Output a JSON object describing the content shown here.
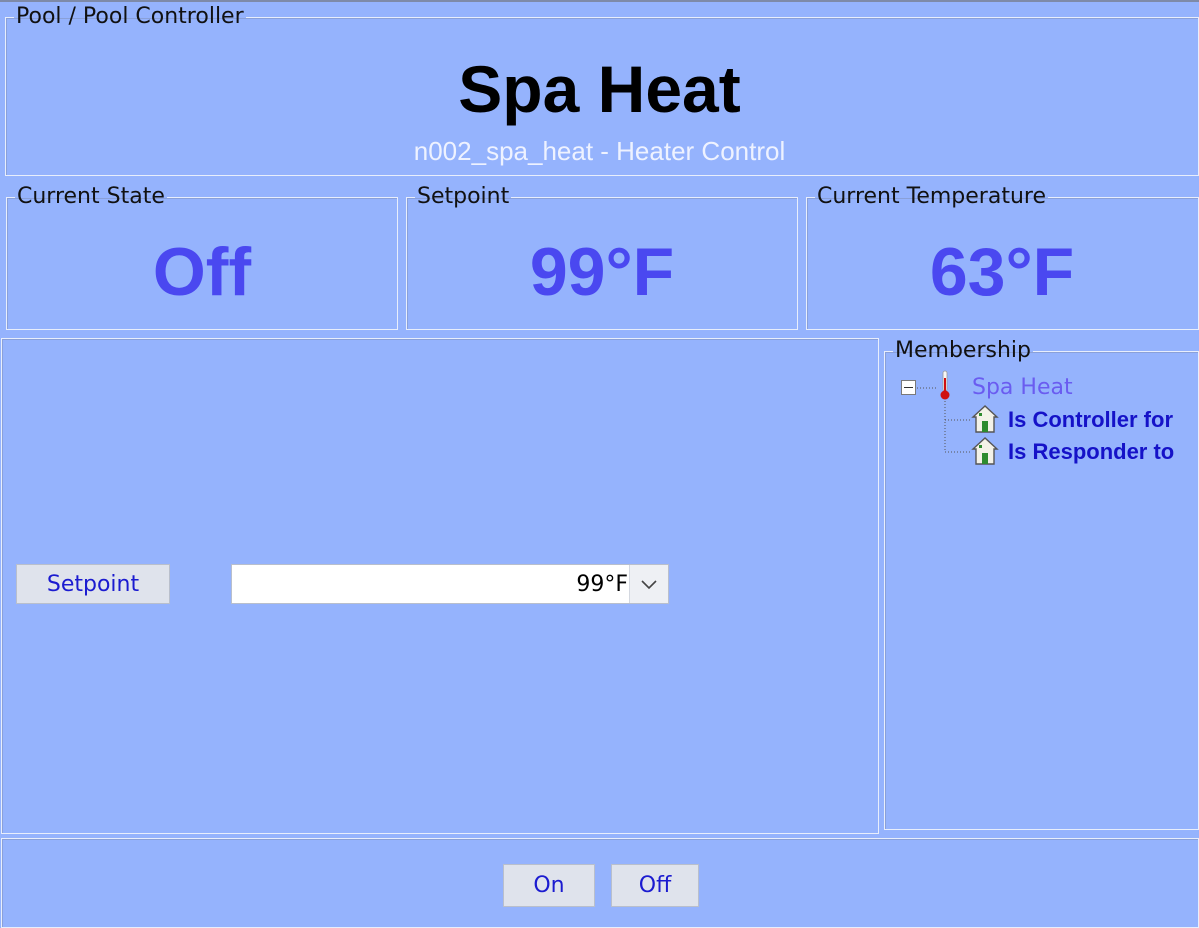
{
  "header": {
    "breadcrumb": "Pool / Pool Controller",
    "title": "Spa Heat",
    "subtitle": "n002_spa_heat - Heater Control"
  },
  "status": {
    "current_state": {
      "label": "Current State",
      "value": "Off"
    },
    "setpoint": {
      "label": "Setpoint",
      "value": "99°F"
    },
    "current_temperature": {
      "label": "Current Temperature",
      "value": "63°F"
    }
  },
  "controls": {
    "setpoint_button": "Setpoint",
    "setpoint_select_value": "99°F"
  },
  "membership": {
    "legend": "Membership",
    "root": "Spa Heat",
    "children": [
      "Is Controller for",
      "Is Responder to"
    ]
  },
  "footer": {
    "on_button": "On",
    "off_button": "Off"
  },
  "colors": {
    "background": "#95b3fd",
    "value_accent": "#4a48f0",
    "button_text": "#1b1bd0"
  }
}
